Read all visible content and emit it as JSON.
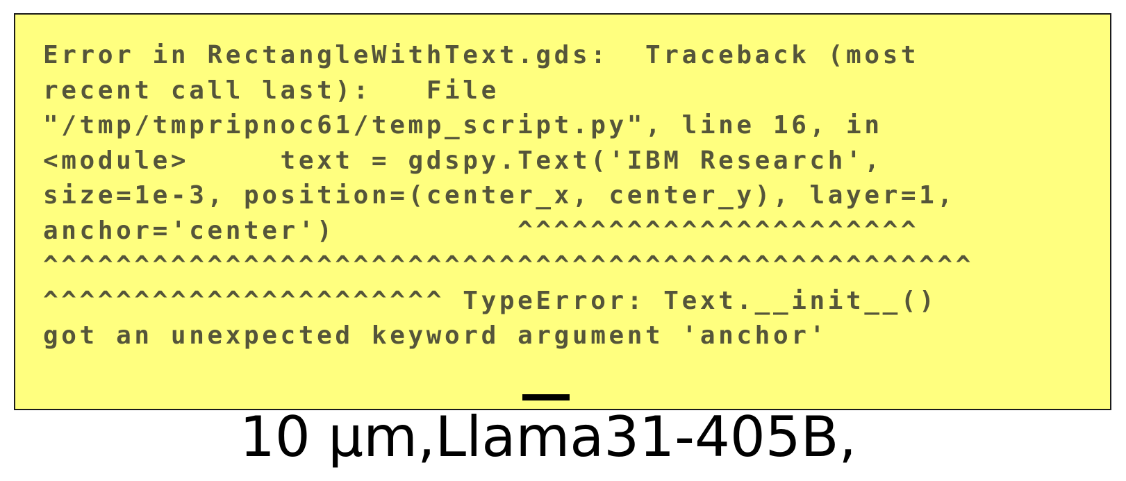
{
  "error_panel": {
    "lines": [
      "Error in RectangleWithText.gds:  Traceback (most",
      "recent call last):   File",
      "\"/tmp/tmpripnoc61/temp_script.py\", line 16, in",
      "<module>     text = gdspy.Text('IBM Research',",
      "size=1e-3, position=(center_x, center_y), layer=1,",
      "anchor='center')          ^^^^^^^^^^^^^^^^^^^^^^",
      "^^^^^^^^^^^^^^^^^^^^^^^^^^^^^^^^^^^^^^^^^^^^^^^^^^^",
      "^^^^^^^^^^^^^^^^^^^^^^ TypeError: Text.__init__()",
      "got an unexpected keyword argument 'anchor'"
    ],
    "background_color": "#ffff7f",
    "text_color": "#55553a"
  },
  "caption": {
    "text": "10 μm,Llama31-405B,"
  }
}
